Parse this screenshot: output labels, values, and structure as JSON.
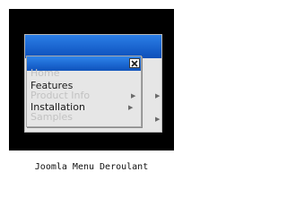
{
  "menu": {
    "items": [
      {
        "label": "Home",
        "enabled": false,
        "has_submenu": false
      },
      {
        "label": "Features",
        "enabled": true,
        "has_submenu": false
      },
      {
        "label": "Product Info",
        "enabled": false,
        "has_submenu": true
      },
      {
        "label": "Installation",
        "enabled": true,
        "has_submenu": true
      },
      {
        "label": "Samples",
        "enabled": false,
        "has_submenu": false
      }
    ],
    "submenu_arrow_glyph": "▶",
    "close_icon": "close-icon"
  },
  "caption": "Joomla Menu Deroulant",
  "colors": {
    "title_bar": "#1a64cf",
    "menu_background": "#e6e6e6",
    "disabled_text": "#c2c2c2",
    "frame": "#000000"
  }
}
